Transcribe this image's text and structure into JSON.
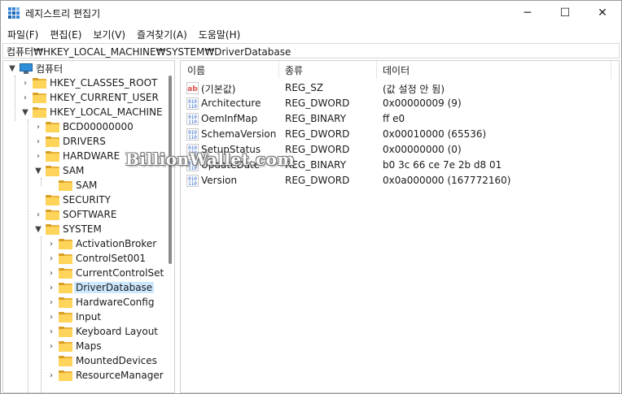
{
  "window": {
    "title": "레지스트리 편집기",
    "controls": {
      "minimize": "─",
      "maximize": "☐",
      "close": "✕"
    }
  },
  "menu": [
    "파일(F)",
    "편집(E)",
    "보기(V)",
    "즐겨찾기(A)",
    "도움말(H)"
  ],
  "address": "컴퓨터₩HKEY_LOCAL_MACHINE₩SYSTEM₩DriverDatabase",
  "tree": {
    "root": "컴퓨터",
    "hives": [
      "HKEY_CLASSES_ROOT",
      "HKEY_CURRENT_USER",
      "HKEY_LOCAL_MACHINE"
    ],
    "hklm_children": [
      "BCD00000000",
      "DRIVERS",
      "HARDWARE",
      "SAM",
      "SECURITY",
      "SOFTWARE",
      "SYSTEM"
    ],
    "sam_children": [
      "SAM"
    ],
    "system_children": [
      "ActivationBroker",
      "ControlSet001",
      "CurrentControlSet",
      "DriverDatabase",
      "HardwareConfig",
      "Input",
      "Keyboard Layout",
      "Maps",
      "MountedDevices",
      "ResourceManager"
    ],
    "selected": "DriverDatabase"
  },
  "columns": {
    "name": "이름",
    "type": "종류",
    "data": "데이터"
  },
  "values": [
    {
      "name": "(기본값)",
      "type": "REG_SZ",
      "data": "(값 설정 안 됨)",
      "icon": "string-value-icon"
    },
    {
      "name": "Architecture",
      "type": "REG_DWORD",
      "data": "0x00000009 (9)",
      "icon": "binary-value-icon"
    },
    {
      "name": "OemInfMap",
      "type": "REG_BINARY",
      "data": "ff e0",
      "icon": "binary-value-icon"
    },
    {
      "name": "SchemaVersion",
      "type": "REG_DWORD",
      "data": "0x00010000 (65536)",
      "icon": "binary-value-icon"
    },
    {
      "name": "SetupStatus",
      "type": "REG_DWORD",
      "data": "0x00000000 (0)",
      "icon": "binary-value-icon"
    },
    {
      "name": "UpdateDate",
      "type": "REG_BINARY",
      "data": "b0 3c 66 ce 7e 2b d8 01",
      "icon": "binary-value-icon"
    },
    {
      "name": "Version",
      "type": "REG_DWORD",
      "data": "0x0a000000 (167772160)",
      "icon": "binary-value-icon"
    }
  ],
  "watermark": "BillionWallet.com",
  "colors": {
    "folder": "#ffd45a",
    "selection": "#cce8ff",
    "string_icon": "#d9534f",
    "binary_icon": "#2a62c9"
  }
}
